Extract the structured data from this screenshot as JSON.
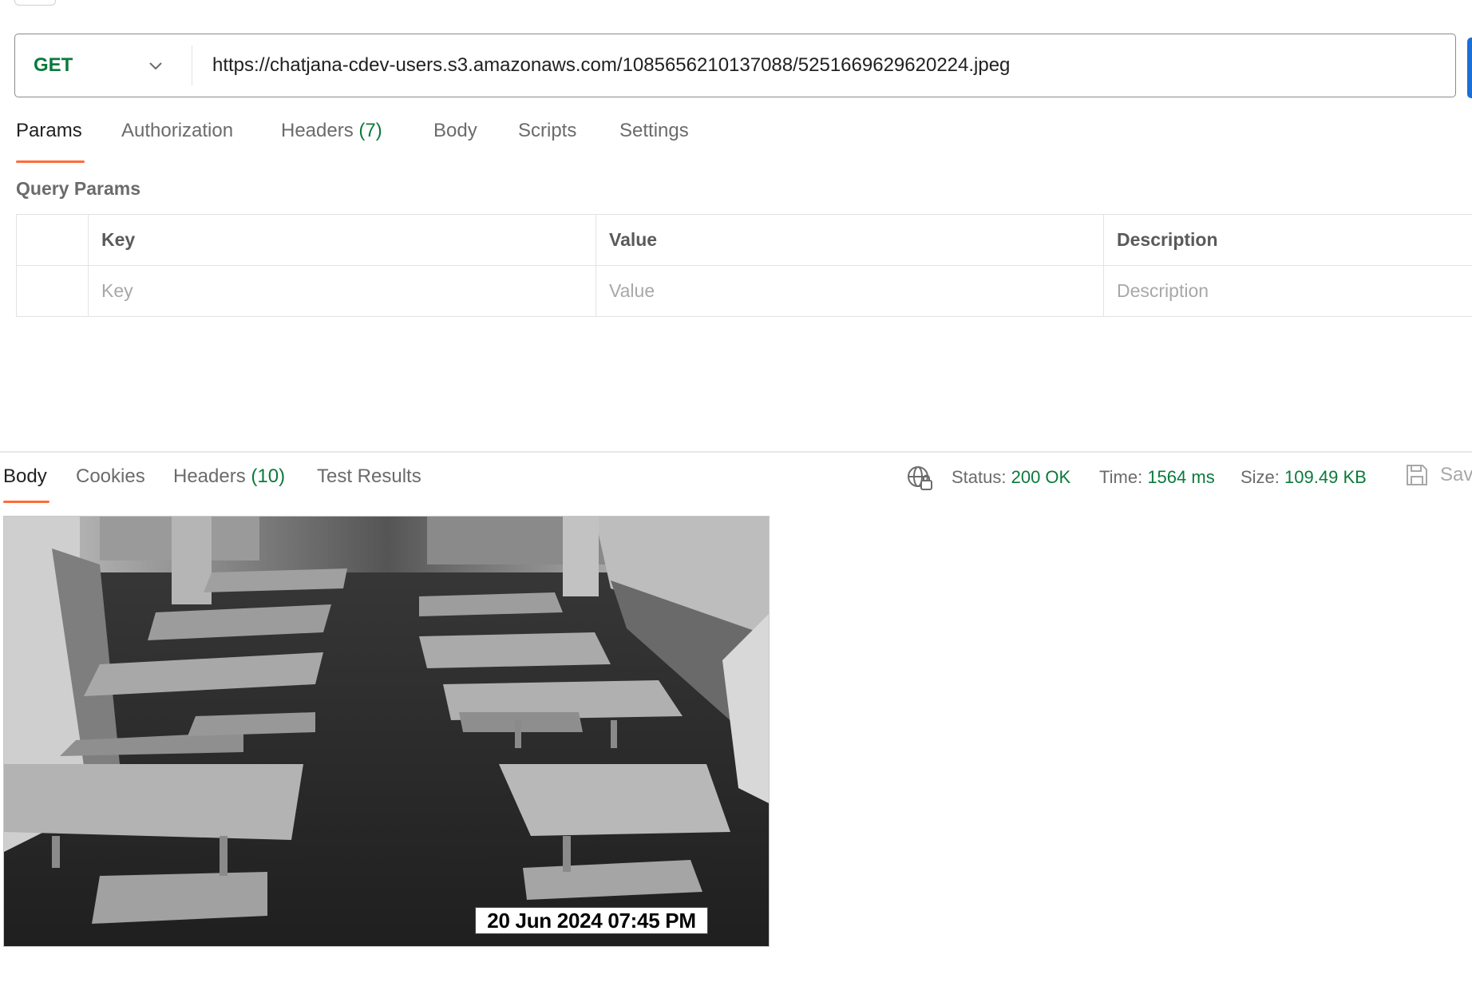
{
  "request": {
    "method": "GET",
    "url": "https://chatjana-cdev-users.s3.amazonaws.com/1085656210137088/5251669629620224.jpeg"
  },
  "request_tabs": [
    {
      "label": "Params",
      "count": ""
    },
    {
      "label": "Authorization",
      "count": ""
    },
    {
      "label": "Headers",
      "count": "(7)"
    },
    {
      "label": "Body",
      "count": ""
    },
    {
      "label": "Scripts",
      "count": ""
    },
    {
      "label": "Settings",
      "count": ""
    }
  ],
  "query_params": {
    "title": "Query Params",
    "headers": [
      "Key",
      "Value",
      "Description"
    ],
    "placeholders": [
      "Key",
      "Value",
      "Description"
    ]
  },
  "response_tabs": [
    {
      "label": "Body",
      "count": ""
    },
    {
      "label": "Cookies",
      "count": ""
    },
    {
      "label": "Headers",
      "count": "(10)"
    },
    {
      "label": "Test Results",
      "count": ""
    }
  ],
  "response_meta": {
    "status_label": "Status:",
    "status_value": "200 OK",
    "time_label": "Time:",
    "time_value": "1564 ms",
    "size_label": "Size:",
    "size_value": "109.49 KB",
    "save_label": "Sav"
  },
  "response_image": {
    "timestamp": "20 Jun 2024 07:45 PM"
  },
  "colors": {
    "accent": "#ff6c37",
    "success": "#0b7a3b",
    "send": "#1b6fd6"
  }
}
